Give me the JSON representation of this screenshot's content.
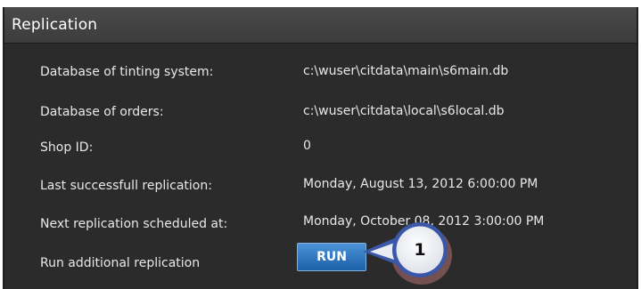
{
  "panel": {
    "title": "Replication"
  },
  "rows": [
    {
      "label": "Database of tinting system:",
      "value": "c:\\wuser\\citdata\\main\\s6main.db"
    },
    {
      "label": "Database of orders:",
      "value": "c:\\wuser\\citdata\\local\\s6local.db"
    },
    {
      "label": "Shop ID:",
      "value": "0"
    },
    {
      "label": "Last successfull replication:",
      "value": "Monday, August 13, 2012 6:00:00 PM"
    },
    {
      "label": "Next replication scheduled at:",
      "value": "Monday, October 08, 2012 3:00:00 PM"
    },
    {
      "label": "Run additional replication",
      "value": ""
    }
  ],
  "run_button": {
    "label": "RUN"
  },
  "callout": {
    "number": "1"
  },
  "colors": {
    "panel_background": "#2b2b2b",
    "header_background": "#434343",
    "button_blue": "#2a6fbf",
    "callout_fill": "#f0f2f5",
    "callout_ring": "#3a57a8",
    "callout_shadow": "#b07070"
  }
}
